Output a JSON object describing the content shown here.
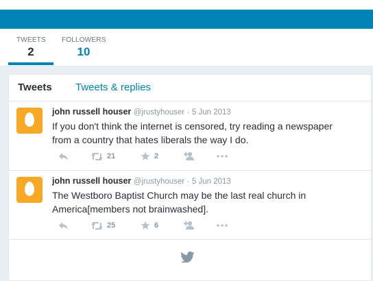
{
  "profile_nav": {
    "tweets_label": "TWEETS",
    "tweets_count": "2",
    "followers_label": "FOLLOWERS",
    "followers_count": "10"
  },
  "timeline": {
    "tab_tweets": "Tweets",
    "tab_replies": "Tweets & replies",
    "tweets": [
      {
        "name": "john russell houser",
        "handle": "@jrustyhouser",
        "separator": "·",
        "time": "5 Jun 2013",
        "text": "If you don't think the internet is censored, try reading a newspaper from a country that hates liberals the way I do.",
        "retweets": "21",
        "favorites": "2"
      },
      {
        "name": "john russell houser",
        "handle": "@jrustyhouser",
        "separator": "·",
        "time": "5 Jun 2013",
        "text": "The Westboro Baptist Church may be the last real church in America[members not brainwashed].",
        "retweets": "25",
        "favorites": "6"
      }
    ]
  },
  "icons": {
    "reply": "reply-icon",
    "retweet": "retweet-icon",
    "favorite": "star-icon",
    "follow": "add-user-icon",
    "more": "more-icon",
    "footer": "twitter-bird-icon"
  },
  "colors": {
    "brand": "#0084b4",
    "avatar": "#f7a926",
    "muted": "#8899a6",
    "text": "#292f33"
  }
}
